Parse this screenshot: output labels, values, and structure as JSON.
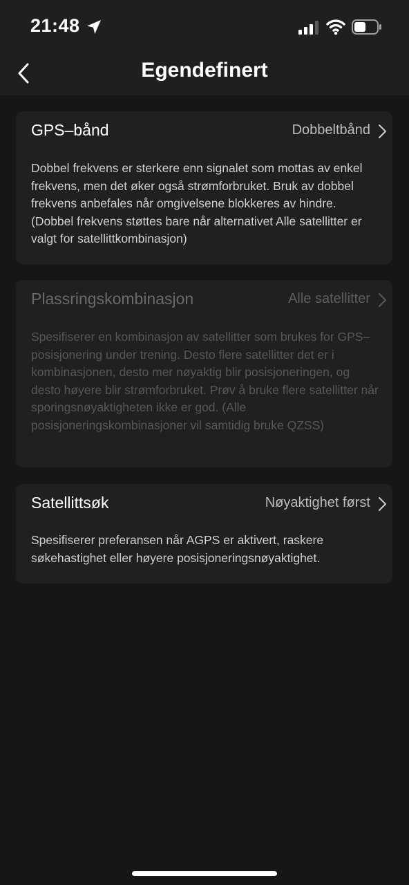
{
  "status_bar": {
    "time": "21:48",
    "icons": [
      "location-arrow-icon",
      "cellular-signal-icon",
      "wifi-icon",
      "battery-icon"
    ]
  },
  "nav": {
    "title": "Egendefinert",
    "back_icon": "chevron-left-icon"
  },
  "settings": [
    {
      "title": "GPS–bånd",
      "value": "Dobbeltbånd",
      "enabled": true,
      "description": "Dobbel frekvens er sterkere enn signalet som mottas av enkel frekvens, men det øker også strømforbruket. Bruk av dobbel frekvens anbefales når omgivelsene blokkeres av hindre. (Dobbel frekvens støttes bare når alternativet Alle satellitter er valgt for satellittkombinasjon)"
    },
    {
      "title": "Plassringskombinasjon",
      "value": "Alle satellitter",
      "enabled": false,
      "description": "Spesifiserer en kombinasjon av satellitter som brukes for GPS–posisjonering under trening. Desto flere satellitter det er i kombinasjonen, desto mer nøyaktig blir posisjoneringen, og desto høyere blir strømforbruket. Prøv å bruke flere satellitter når sporingsnøyaktigheten ikke er god. (Alle posisjoneringskombinasjoner vil samtidig bruke QZSS)"
    },
    {
      "title": "Satellittsøk",
      "value": "Nøyaktighet først",
      "enabled": true,
      "description": "Spesifiserer preferansen når AGPS er aktivert, raskere søkehastighet eller høyere posisjoneringsnøyaktighet."
    }
  ],
  "colors": {
    "background": "#161616",
    "card": "#202020",
    "header": "#1f1f1f",
    "text_primary": "#ffffff",
    "text_value": "#bdbdbd",
    "text_disabled": "#575757"
  }
}
